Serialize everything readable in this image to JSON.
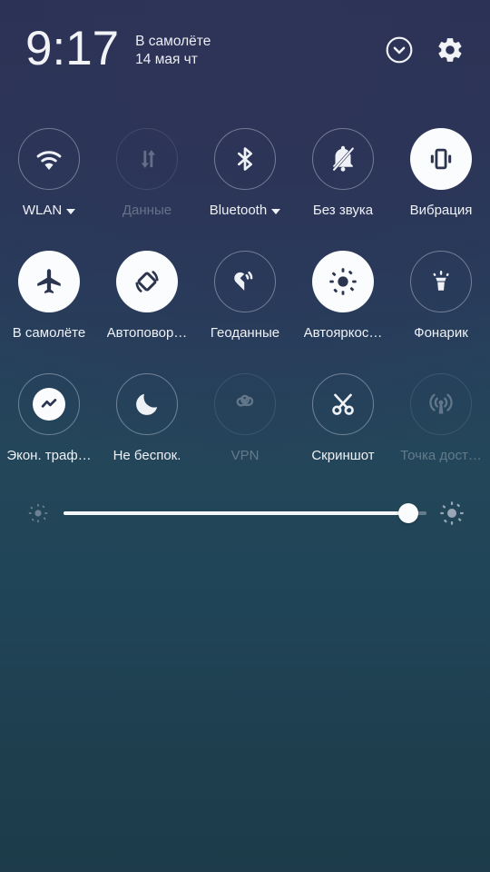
{
  "header": {
    "clock": "9:17",
    "status_primary": "В самолёте",
    "status_secondary": "14 мая чт",
    "collapse_icon": "chevron-down-circle-icon",
    "settings_icon": "gear-icon"
  },
  "tiles": [
    [
      {
        "label": "WLAN",
        "icon": "wifi-icon",
        "state": "off",
        "caret": true
      },
      {
        "label": "Данные",
        "icon": "mobile-data-icon",
        "state": "disabled",
        "caret": false
      },
      {
        "label": "Bluetooth",
        "icon": "bluetooth-icon",
        "state": "off",
        "caret": true
      },
      {
        "label": "Без звука",
        "icon": "bell-muted-icon",
        "state": "off",
        "caret": false
      },
      {
        "label": "Вибрация",
        "icon": "vibration-icon",
        "state": "on",
        "caret": false
      }
    ],
    [
      {
        "label": "В самолёте",
        "icon": "airplane-icon",
        "state": "on",
        "caret": false
      },
      {
        "label": "Автоповор…",
        "icon": "auto-rotate-icon",
        "state": "on",
        "caret": false
      },
      {
        "label": "Геоданные",
        "icon": "location-icon",
        "state": "off",
        "caret": false
      },
      {
        "label": "Автояркос…",
        "icon": "auto-brightness-icon",
        "state": "on",
        "caret": false
      },
      {
        "label": "Фонарик",
        "icon": "flashlight-icon",
        "state": "off",
        "caret": false
      }
    ],
    [
      {
        "label": "Экон. траф…",
        "icon": "data-saver-icon",
        "state": "inner",
        "caret": false
      },
      {
        "label": "Не беспок.",
        "icon": "do-not-disturb-icon",
        "state": "off",
        "caret": false
      },
      {
        "label": "VPN",
        "icon": "vpn-key-icon",
        "state": "disabled",
        "caret": false
      },
      {
        "label": "Скриншот",
        "icon": "scissors-icon",
        "state": "off",
        "caret": false
      },
      {
        "label": "Точка дост…",
        "icon": "hotspot-icon",
        "state": "disabled",
        "caret": false
      }
    ]
  ],
  "brightness": {
    "value_percent": 95,
    "low_icon": "brightness-low-icon",
    "high_icon": "brightness-high-icon"
  },
  "colors": {
    "bg_top": "#2b3154",
    "bg_bottom": "#1d3b4a",
    "tile_active_fill": "#fbfcfd",
    "tile_icon_dark": "#2c3550",
    "text": "#eef1f6"
  }
}
